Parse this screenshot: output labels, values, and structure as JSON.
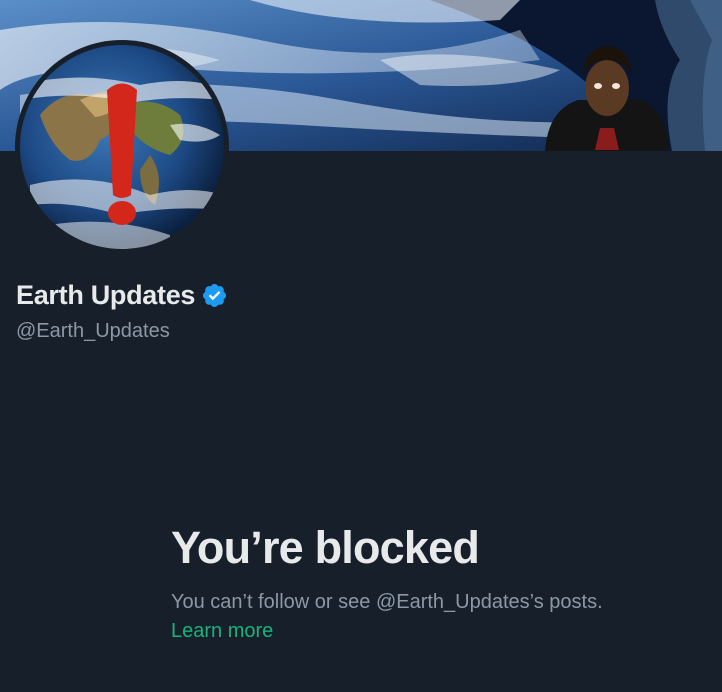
{
  "profile": {
    "display_name": "Earth Updates",
    "handle": "@Earth_Updates",
    "verified": true
  },
  "blocked": {
    "title": "You’re blocked",
    "description": "You can’t follow or see @Earth_Updates’s posts.",
    "learn_more": "Learn more"
  },
  "colors": {
    "background": "#17202a",
    "text_primary": "#e7e9ea",
    "text_secondary": "#8b98a5",
    "verified_blue": "#1d9bf0",
    "link_green": "#1ab27a",
    "avatar_mark_red": "#d3271c"
  },
  "icons": {
    "verified": "verified-badge-icon",
    "avatar_mark": "exclamation-mark"
  }
}
